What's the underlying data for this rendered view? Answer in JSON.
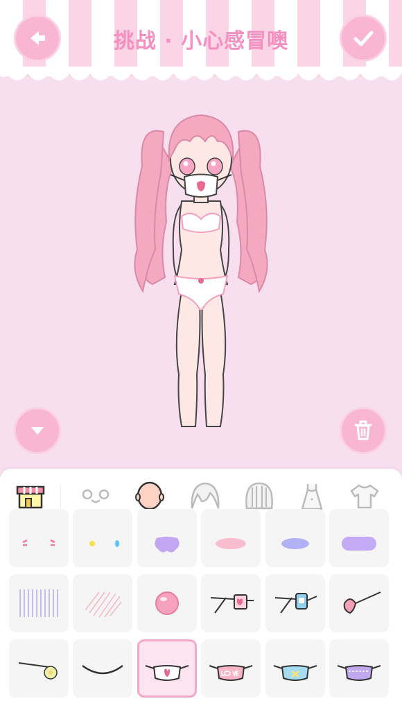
{
  "header": {
    "title": "挑战 · 小心感冒噢"
  },
  "buttons": {
    "back": "back-arrow-icon",
    "confirm": "checkmark-icon",
    "collapse": "chevron-down-icon",
    "delete": "trash-icon"
  },
  "colors": {
    "accent": "#f9b6d3",
    "background": "#f8dff0",
    "title": "#f58fc0",
    "selected_border": "#f5a7c8"
  },
  "tabs": [
    {
      "name": "shop",
      "icon": "shop-icon",
      "selected": false
    },
    {
      "name": "face",
      "icon": "face-icon",
      "selected": false
    },
    {
      "name": "skin",
      "icon": "head-icon",
      "selected": true
    },
    {
      "name": "hair-front",
      "icon": "hair-front-icon",
      "selected": false
    },
    {
      "name": "hair-back",
      "icon": "hair-back-icon",
      "selected": false
    },
    {
      "name": "dress",
      "icon": "dress-icon",
      "selected": false
    },
    {
      "name": "shirt",
      "icon": "shirt-icon",
      "selected": false
    }
  ],
  "items": [
    {
      "icon": "blush-marks-icon"
    },
    {
      "icon": "sparkle-tears-icon"
    },
    {
      "icon": "purple-puff-icon"
    },
    {
      "icon": "pink-blush-icon"
    },
    {
      "icon": "blue-blush-icon"
    },
    {
      "icon": "purple-blush-icon"
    },
    {
      "icon": "purple-lines-icon"
    },
    {
      "icon": "pink-hatch-icon"
    },
    {
      "icon": "pink-ball-icon"
    },
    {
      "icon": "pink-patch-mask-icon"
    },
    {
      "icon": "blue-patch-mask-icon"
    },
    {
      "icon": "heart-pin-icon"
    },
    {
      "icon": "yellow-flower-pin-icon"
    },
    {
      "icon": "string-icon"
    },
    {
      "icon": "white-mask-icon",
      "selected": true
    },
    {
      "icon": "love-mask-icon"
    },
    {
      "icon": "blue-mask-icon"
    },
    {
      "icon": "purple-mask-icon"
    }
  ]
}
